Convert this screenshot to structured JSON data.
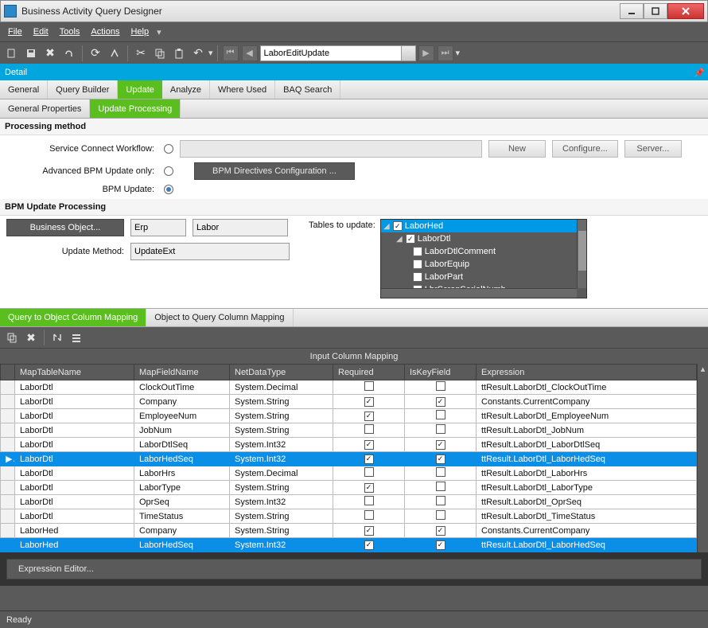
{
  "window_title": "Business Activity Query Designer",
  "menu": {
    "file": "File",
    "edit": "Edit",
    "tools": "Tools",
    "actions": "Actions",
    "help": "Help"
  },
  "nav_combo": {
    "value": "LaborEditUpdate"
  },
  "detail_strip": "Detail",
  "main_tabs": {
    "general": "General",
    "query_builder": "Query Builder",
    "update": "Update",
    "analyze": "Analyze",
    "where_used": "Where Used",
    "baq_search": "BAQ Search"
  },
  "sub_tabs": {
    "general_props": "General Properties",
    "update_processing": "Update Processing"
  },
  "processing": {
    "title": "Processing method",
    "svc_workflow_label": "Service Connect Workflow:",
    "adv_bpm_label": "Advanced BPM Update only:",
    "bpm_update_label": "BPM Update:",
    "new_btn": "New",
    "configure_btn": "Configure...",
    "server_btn": "Server...",
    "bpm_cfg_btn": "BPM Directives Configuration ..."
  },
  "bpm": {
    "title": "BPM Update Processing",
    "business_object_btn": "Business Object...",
    "bo_ns": "Erp",
    "bo_name": "Labor",
    "update_method_label": "Update Method:",
    "update_method_value": "UpdateExt",
    "tables_label": "Tables to update:",
    "tree": {
      "n0": "LaborHed",
      "n1": "LaborDtl",
      "n2": "LaborDtlComment",
      "n3": "LaborEquip",
      "n4": "LaborPart",
      "n5": "LbrScrapSerialNumb"
    }
  },
  "map_tabs": {
    "q2o": "Query to Object Column Mapping",
    "o2q": "Object to Query Column Mapping"
  },
  "grid": {
    "title": "Input Column Mapping",
    "headers": {
      "maptable": "MapTableName",
      "mapfield": "MapFieldName",
      "netdt": "NetDataType",
      "required": "Required",
      "iskey": "IsKeyField",
      "expr": "Expression"
    },
    "rows": [
      {
        "table": "LaborDtl",
        "field": "ClockOutTime",
        "type": "System.Decimal",
        "required": false,
        "iskey": false,
        "expr": "ttResult.LaborDtl_ClockOutTime",
        "sel": false
      },
      {
        "table": "LaborDtl",
        "field": "Company",
        "type": "System.String",
        "required": true,
        "iskey": true,
        "expr": "Constants.CurrentCompany",
        "sel": false
      },
      {
        "table": "LaborDtl",
        "field": "EmployeeNum",
        "type": "System.String",
        "required": true,
        "iskey": false,
        "expr": "ttResult.LaborDtl_EmployeeNum",
        "sel": false
      },
      {
        "table": "LaborDtl",
        "field": "JobNum",
        "type": "System.String",
        "required": false,
        "iskey": false,
        "expr": "ttResult.LaborDtl_JobNum",
        "sel": false
      },
      {
        "table": "LaborDtl",
        "field": "LaborDtlSeq",
        "type": "System.Int32",
        "required": true,
        "iskey": true,
        "expr": "ttResult.LaborDtl_LaborDtlSeq",
        "sel": false
      },
      {
        "table": "LaborDtl",
        "field": "LaborHedSeq",
        "type": "System.Int32",
        "required": true,
        "iskey": true,
        "expr": "ttResult.LaborDtl_LaborHedSeq",
        "sel": true,
        "marker": "▶"
      },
      {
        "table": "LaborDtl",
        "field": "LaborHrs",
        "type": "System.Decimal",
        "required": false,
        "iskey": false,
        "expr": "ttResult.LaborDtl_LaborHrs",
        "sel": false
      },
      {
        "table": "LaborDtl",
        "field": "LaborType",
        "type": "System.String",
        "required": true,
        "iskey": false,
        "expr": "ttResult.LaborDtl_LaborType",
        "sel": false
      },
      {
        "table": "LaborDtl",
        "field": "OprSeq",
        "type": "System.Int32",
        "required": false,
        "iskey": false,
        "expr": "ttResult.LaborDtl_OprSeq",
        "sel": false
      },
      {
        "table": "LaborDtl",
        "field": "TimeStatus",
        "type": "System.String",
        "required": false,
        "iskey": false,
        "expr": "ttResult.LaborDtl_TimeStatus",
        "sel": false
      },
      {
        "table": "LaborHed",
        "field": "Company",
        "type": "System.String",
        "required": true,
        "iskey": true,
        "expr": "Constants.CurrentCompany",
        "sel": false
      },
      {
        "table": "LaborHed",
        "field": "LaborHedSeq",
        "type": "System.Int32",
        "required": true,
        "iskey": true,
        "expr": "ttResult.LaborDtl_LaborHedSeq",
        "sel": true
      }
    ]
  },
  "expr_editor_btn": "Expression Editor...",
  "status": "Ready"
}
